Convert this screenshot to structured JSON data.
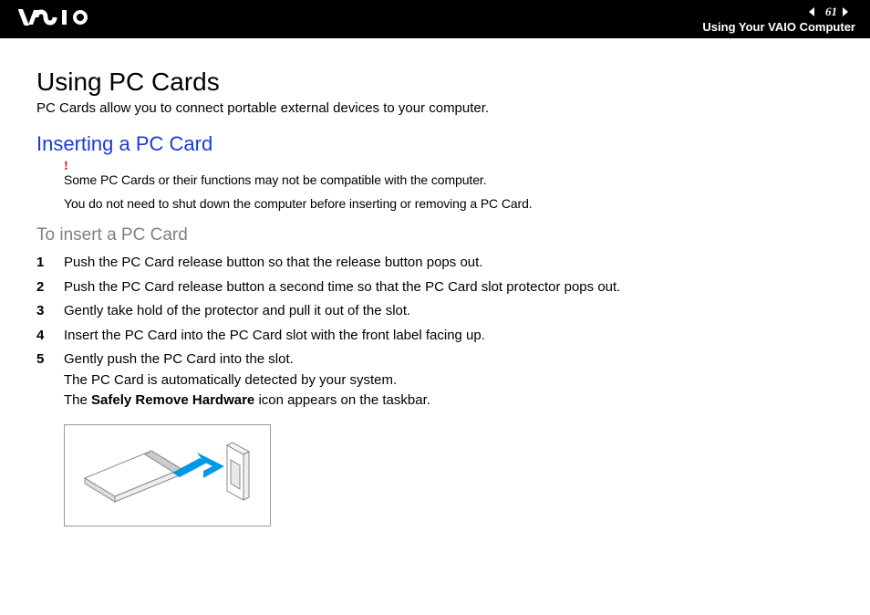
{
  "header": {
    "page_number": "61",
    "breadcrumb": "Using Your VAIO Computer"
  },
  "title": "Using PC Cards",
  "intro": "PC Cards allow you to connect portable external devices to your computer.",
  "section_heading": "Inserting a PC Card",
  "warning_mark": "!",
  "warning_note": "Some PC Cards or their functions may not be compatible with the computer.",
  "info_note": "You do not need to shut down the computer before inserting or removing a PC Card.",
  "procedure_heading": "To insert a PC Card",
  "steps": [
    {
      "n": "1",
      "text": "Push the PC Card release button so that the release button pops out."
    },
    {
      "n": "2",
      "text": "Push the PC Card release button a second time so that the PC Card slot protector pops out."
    },
    {
      "n": "3",
      "text": "Gently take hold of the protector and pull it out of the slot."
    },
    {
      "n": "4",
      "text": "Insert the PC Card into the PC Card slot with the front label facing up."
    },
    {
      "n": "5",
      "text": "Gently push the PC Card into the slot.",
      "text2": "The PC Card is automatically detected by your system.",
      "text3_pre": "The ",
      "text3_bold": "Safely Remove Hardware",
      "text3_post": " icon appears on the taskbar."
    }
  ]
}
